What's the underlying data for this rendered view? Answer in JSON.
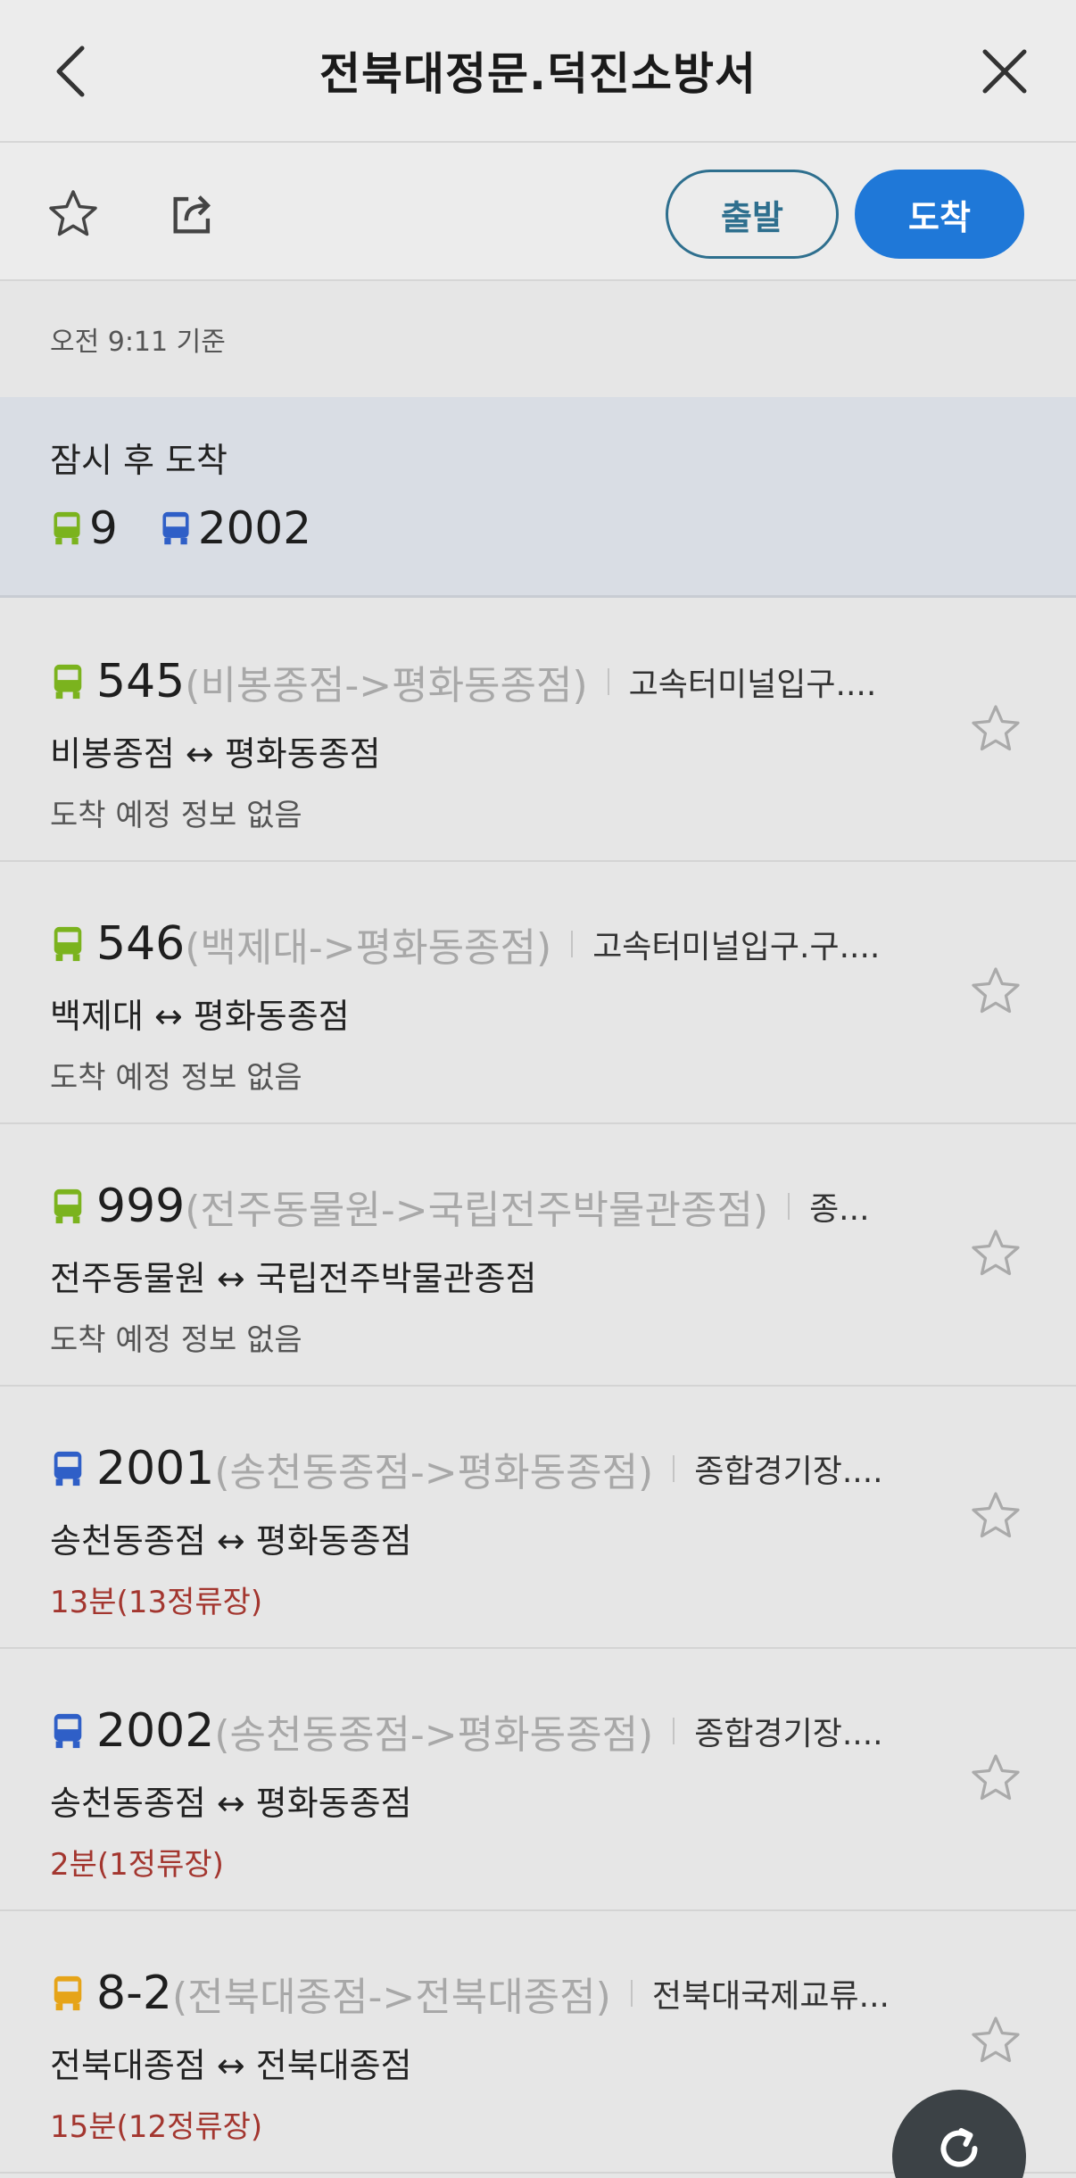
{
  "header": {
    "title": "전북대정문.덕진소방서",
    "back_icon": "chevron-left-icon",
    "close_icon": "close-icon"
  },
  "toolbar": {
    "favorite_icon": "star-outline-icon",
    "share_icon": "share-icon",
    "depart_label": "출발",
    "arrive_label": "도착"
  },
  "time_basis": "오전 9:11 기준",
  "soon": {
    "label": "잠시 후 도착",
    "buses": [
      {
        "number": "9",
        "color": "#7bb31e"
      },
      {
        "number": "2002",
        "color": "#2f5fc7"
      }
    ]
  },
  "routes": [
    {
      "number": "545",
      "direction": "(비봉종점->평화동종점)",
      "next_stop": "고속터미널입구....",
      "route": "비봉종점 ↔ 평화동종점",
      "arrival": "도착 예정 정보 없음",
      "arrival_red": false,
      "color": "#7bb31e"
    },
    {
      "number": "546",
      "direction": "(백제대->평화동종점)",
      "next_stop": "고속터미널입구.구....",
      "route": "백제대 ↔ 평화동종점",
      "arrival": "도착 예정 정보 없음",
      "arrival_red": false,
      "color": "#7bb31e"
    },
    {
      "number": "999",
      "direction": "(전주동물원->국립전주박물관종점)",
      "next_stop": "종...",
      "route": "전주동물원 ↔ 국립전주박물관종점",
      "arrival": "도착 예정 정보 없음",
      "arrival_red": false,
      "color": "#7bb31e"
    },
    {
      "number": "2001",
      "direction": "(송천동종점->평화동종점)",
      "next_stop": "종합경기장....",
      "route": "송천동종점 ↔ 평화동종점",
      "arrival": "13분(13정류장)",
      "arrival_red": true,
      "color": "#2f5fc7"
    },
    {
      "number": "2002",
      "direction": "(송천동종점->평화동종점)",
      "next_stop": "종합경기장....",
      "route": "송천동종점 ↔ 평화동종점",
      "arrival": "2분(1정류장)",
      "arrival_red": true,
      "color": "#2f5fc7"
    },
    {
      "number": "8-2",
      "direction": "(전북대종점->전북대종점)",
      "next_stop": "전북대국제교류...",
      "route": "전북대종점 ↔ 전북대종점",
      "arrival": "15분(12정류장)",
      "arrival_red": true,
      "color": "#e6a418"
    }
  ],
  "refresh_icon": "refresh-icon"
}
